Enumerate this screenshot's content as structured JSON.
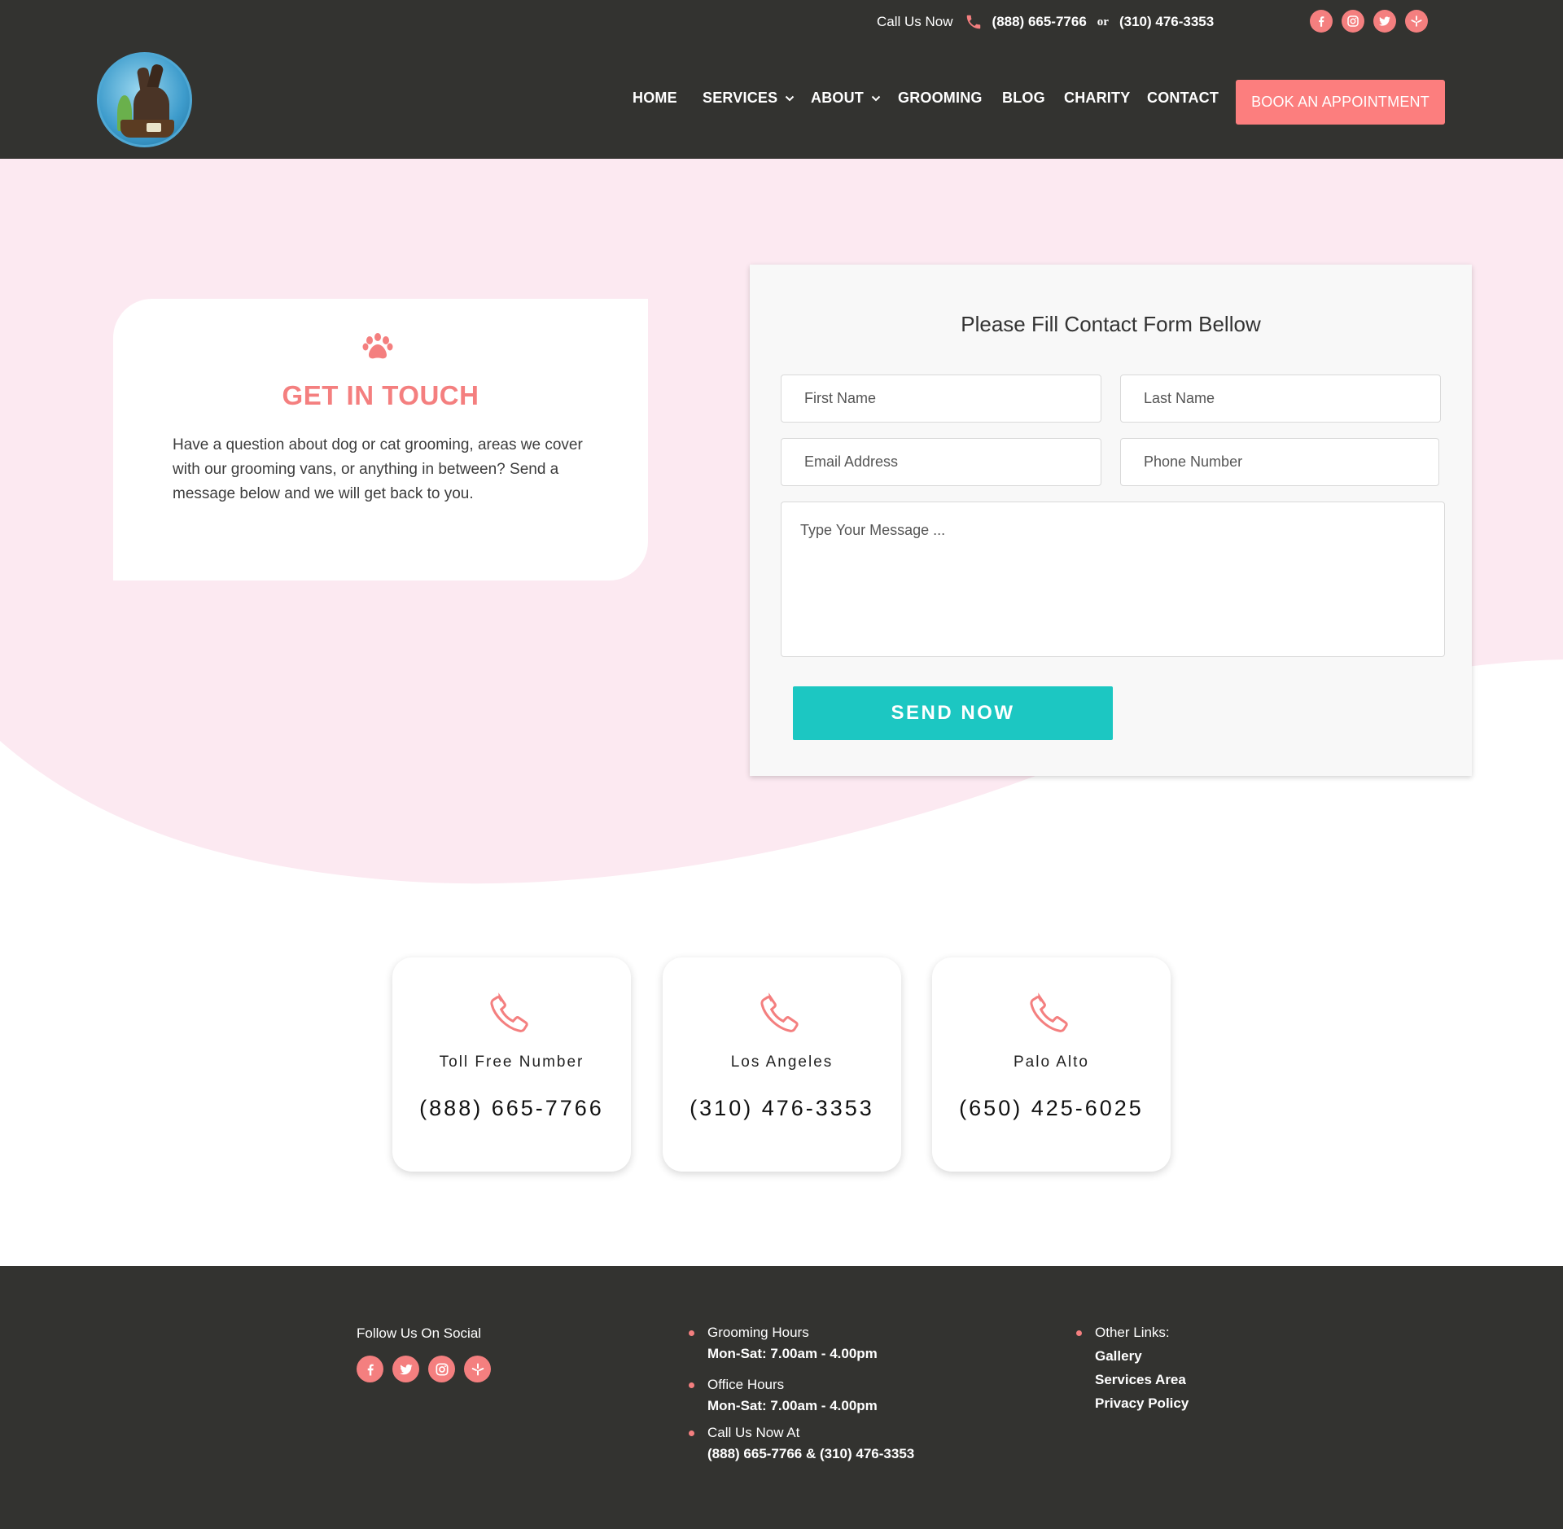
{
  "topbar": {
    "call_label": "Call Us Now",
    "phone1": "(888) 665-7766",
    "or_label": "or",
    "phone2": "(310) 476-3353",
    "social_icons": [
      "facebook-icon",
      "instagram-icon",
      "twitter-icon",
      "yelp-icon"
    ]
  },
  "nav": {
    "items": [
      {
        "label": "HOME"
      },
      {
        "label": "SERVICES"
      },
      {
        "label": "ABOUT"
      },
      {
        "label": "GROOMING"
      },
      {
        "label": "BLOG"
      },
      {
        "label": "CHARITY"
      },
      {
        "label": "CONTACT"
      }
    ],
    "book_button": "BOOK  AN APPOINTMENT"
  },
  "touch": {
    "title": "GET IN TOUCH",
    "text": "Have a question about dog or cat grooming, areas we cover with our grooming vans, or anything in between? Send a message below and we will get back to you."
  },
  "form": {
    "title": "Please Fill Contact Form Bellow",
    "first_name_placeholder": "First Name",
    "last_name_placeholder": "Last Name",
    "email_placeholder": "Email Address",
    "phone_placeholder": "Phone Number",
    "message_placeholder": "Type Your Message ...",
    "submit_label": "SEND NOW"
  },
  "phone_cards": [
    {
      "label": "Toll Free Number",
      "number": "(888) 665-7766"
    },
    {
      "label": "Los Angeles",
      "number": "(310) 476-3353"
    },
    {
      "label": "Palo Alto",
      "number": "(650) 425-6025"
    }
  ],
  "footer": {
    "social_title": "Follow Us On Social",
    "hours": [
      {
        "title": "Grooming Hours",
        "value": "Mon-Sat: 7.00am - 4.00pm"
      },
      {
        "title": "Office Hours",
        "value": "Mon-Sat: 7.00am - 4.00pm"
      },
      {
        "title": "Call Us Now At",
        "value": "(888) 665-7766  &  (310) 476-3353"
      }
    ],
    "links_title": "Other Links:",
    "links": [
      "Gallery",
      "Services Area",
      "Privacy Policy"
    ]
  },
  "colors": {
    "dark": "#333330",
    "accent": "#f47f7f",
    "button_coral": "#fc7e7e",
    "teal": "#1cc7c2",
    "pink_bg": "#fce9f1"
  }
}
